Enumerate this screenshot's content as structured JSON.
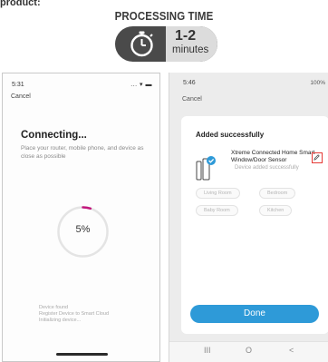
{
  "top_fragment": "product:",
  "processing": {
    "title": "PROCESSING TIME",
    "value": "1-2",
    "unit": "minutes",
    "timer_icon": "stopwatch-icon"
  },
  "phone1": {
    "time": "5:31",
    "status_icons": "... ▾ ▬",
    "cancel": "Cancel",
    "heading": "Connecting...",
    "description": "Place your router, mobile phone, and device as close as possible",
    "progress_percent": 5,
    "progress_label": "5%",
    "status_lines": [
      "Device found",
      "Register Device to Smart Cloud",
      "Initializing device..."
    ]
  },
  "phone2": {
    "time": "5:46",
    "status_right": "100%",
    "cancel": "Cancel",
    "card_title": "Added successfully",
    "device_name": "Xtreme Connected Home Smart Window/Door Sensor",
    "device_sub": "Device added successfully",
    "rooms": [
      "Living Room",
      "Bedroom",
      "Baby Room",
      "Kitchen"
    ],
    "done": "Done",
    "nav": [
      "III",
      "O",
      "<"
    ]
  },
  "colors": {
    "accent": "#2e9ad8",
    "progress": "#c2187d",
    "highlight": "#e53935",
    "badge_dark": "#4a4a4a"
  }
}
